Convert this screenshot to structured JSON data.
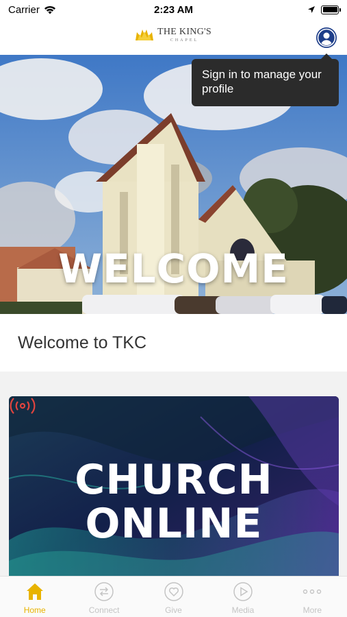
{
  "status_bar": {
    "carrier": "Carrier",
    "time": "2:23 AM"
  },
  "header": {
    "logo_main": "THE KING'S",
    "logo_sub": "CHAPEL",
    "profile_icon": "user-icon"
  },
  "tooltip": {
    "text": "Sign in to manage your profile"
  },
  "hero": {
    "title": "WELCOME"
  },
  "welcome_card": {
    "text": "Welcome to TKC"
  },
  "church_online": {
    "title_line1": "CHURCH",
    "title_line2": "ONLINE",
    "icon": "broadcast-icon",
    "icon_color": "#e0443e"
  },
  "tab_bar": {
    "active_color": "#e8b300",
    "inactive_color": "#c4c4c4",
    "tabs": [
      {
        "label": "Home",
        "icon": "home-icon",
        "active": true
      },
      {
        "label": "Connect",
        "icon": "connect-icon",
        "active": false
      },
      {
        "label": "Give",
        "icon": "heart-icon",
        "active": false
      },
      {
        "label": "Media",
        "icon": "play-icon",
        "active": false
      },
      {
        "label": "More",
        "icon": "more-icon",
        "active": false
      }
    ]
  }
}
